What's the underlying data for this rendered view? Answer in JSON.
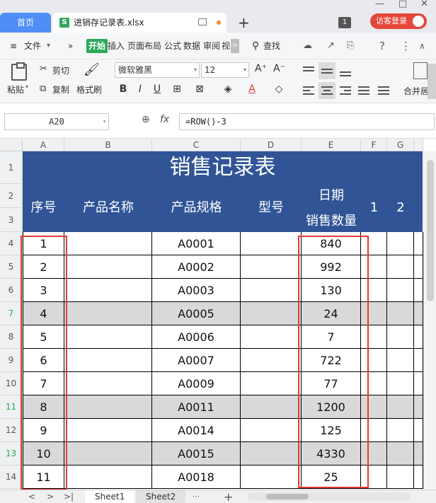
{
  "titlebar": {
    "home_tab": "首页",
    "file_tab": "进销存记录表.xlsx",
    "file_icon": "S",
    "new_tab": "+",
    "window_badge": "1",
    "login": "访客登录",
    "ctl_min": "—",
    "ctl_max": "□",
    "ctl_close": "✕"
  },
  "menubar": {
    "menu_icon": "≡",
    "file": "文件",
    "more": "»",
    "items": [
      "开始",
      "插入",
      "页面布局",
      "公式",
      "数据",
      "审阅",
      "视"
    ],
    "scroll": ">",
    "search": "查找",
    "help": "?",
    "more_dots": "⋮",
    "collapse": "∧"
  },
  "ribbon": {
    "paste": "粘贴",
    "cut": "剪切",
    "copy": "复制",
    "format_painter": "格式刷",
    "font": "微软雅黑",
    "font_size": "12",
    "grow": "A⁺",
    "shrink": "A⁻",
    "bold": "B",
    "italic": "I",
    "underline": "U",
    "merge": "合并居"
  },
  "formulabar": {
    "cell_ref": "A20",
    "zoom": "⊕",
    "fx": "fx",
    "formula": "=ROW()-3"
  },
  "columns": [
    "A",
    "B",
    "C",
    "D",
    "E",
    "F",
    "G"
  ],
  "rows": [
    "1",
    "2",
    "3",
    "4",
    "5",
    "6",
    "7",
    "8",
    "9",
    "10",
    "11",
    "12",
    "13",
    "14"
  ],
  "sheet": {
    "title": "销售记录表",
    "headers": {
      "seq": "序号",
      "product_name": "产品名称",
      "product_spec": "产品规格",
      "model": "型号",
      "date": "日期",
      "qty": "销售数量",
      "col1": "1",
      "col2": "2"
    },
    "data": [
      {
        "seq": "1",
        "spec": "A0001",
        "qty": "840",
        "gray": false
      },
      {
        "seq": "2",
        "spec": "A0002",
        "qty": "992",
        "gray": false
      },
      {
        "seq": "3",
        "spec": "A0003",
        "qty": "130",
        "gray": false
      },
      {
        "seq": "4",
        "spec": "A0005",
        "qty": "24",
        "gray": true
      },
      {
        "seq": "5",
        "spec": "A0006",
        "qty": "7",
        "gray": false
      },
      {
        "seq": "6",
        "spec": "A0007",
        "qty": "722",
        "gray": false
      },
      {
        "seq": "7",
        "spec": "A0009",
        "qty": "77",
        "gray": false
      },
      {
        "seq": "8",
        "spec": "A0011",
        "qty": "1200",
        "gray": true
      },
      {
        "seq": "9",
        "spec": "A0014",
        "qty": "125",
        "gray": false
      },
      {
        "seq": "10",
        "spec": "A0015",
        "qty": "4330",
        "gray": true
      },
      {
        "seq": "11",
        "spec": "A0018",
        "qty": "25",
        "gray": false
      }
    ]
  },
  "sheetbar": {
    "prev": "<",
    "next": ">",
    "last": ">|",
    "sheets": [
      "Sheet1",
      "Sheet2"
    ],
    "add": "+"
  },
  "colors": {
    "banner": "#305496",
    "accent_green": "#2ea85a",
    "highlight_red": "#e53935",
    "row_gray": "#d9d9d9"
  }
}
